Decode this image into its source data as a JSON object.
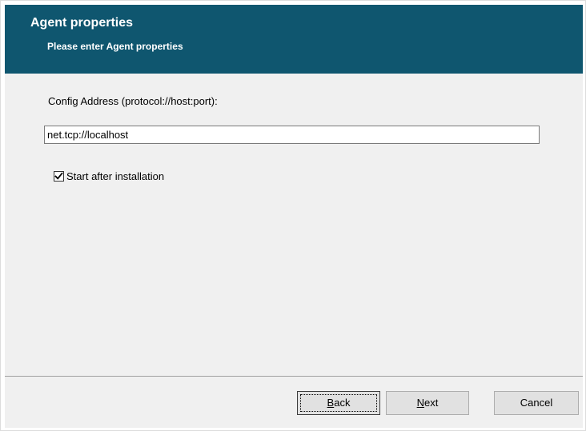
{
  "header": {
    "title": "Agent properties",
    "subtitle": "Please enter Agent properties",
    "background_color": "#0f566f"
  },
  "form": {
    "config_label": "Config Address (protocol://host:port):",
    "config_value": "net.tcp://localhost",
    "start_checkbox": {
      "label": "Start after installation",
      "checked": true
    }
  },
  "footer": {
    "back": {
      "mnemonic": "B",
      "rest": "ack"
    },
    "next": {
      "mnemonic": "N",
      "rest": "ext"
    },
    "cancel_label": "Cancel"
  }
}
